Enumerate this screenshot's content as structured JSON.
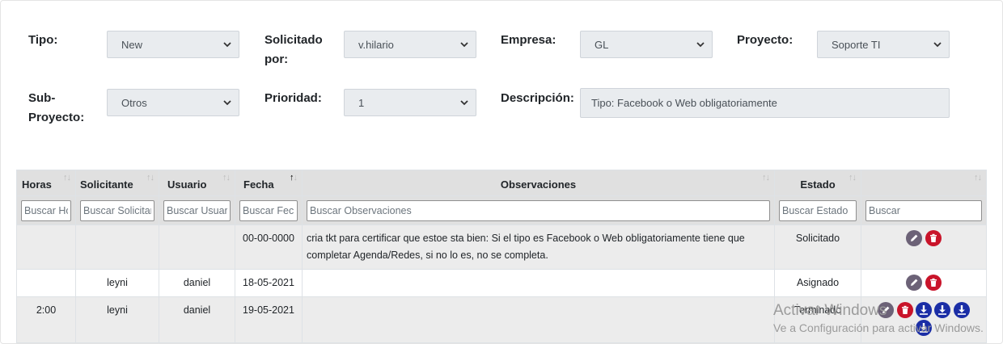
{
  "form": {
    "tipo": {
      "label": "Tipo:",
      "value": "New"
    },
    "solicitado": {
      "label_line1": "Solicitado",
      "label_line2": "por:",
      "value": "v.hilario"
    },
    "empresa": {
      "label": "Empresa:",
      "value": "GL"
    },
    "proyecto": {
      "label": "Proyecto:",
      "value": "Soporte TI"
    },
    "subproyecto": {
      "label_line1": "Sub-",
      "label_line2": "Proyecto:",
      "value": "Otros"
    },
    "prioridad": {
      "label": "Prioridad:",
      "value": "1"
    },
    "descripcion": {
      "label": "Descripción:",
      "value": "Tipo: Facebook o Web obligatoriamente"
    }
  },
  "table": {
    "columns": [
      "Horas",
      "Solicitante",
      "Usuario",
      "Fecha",
      "Observaciones",
      "Estado",
      ""
    ],
    "filters": [
      "Buscar Horas",
      "Buscar Solicitante",
      "Buscar Usuario",
      "Buscar Fecha",
      "Buscar Observaciones",
      "Buscar Estado",
      "Buscar"
    ],
    "rows": [
      {
        "horas": "",
        "solicitante": "",
        "usuario": "",
        "fecha": "00-00-0000",
        "observaciones": "cria tkt para certificar que estoe sta bien: Si el tipo es Facebook o Web obligatoriamente tiene que completar Agenda/Redes, si no lo es, no se completa.",
        "estado": "Solicitado",
        "actions": [
          "edit-icon",
          "delete-icon"
        ]
      },
      {
        "horas": "",
        "solicitante": "leyni",
        "usuario": "daniel",
        "fecha": "18-05-2021",
        "observaciones": "",
        "estado": "Asignado",
        "actions": [
          "edit-icon",
          "delete-icon"
        ]
      },
      {
        "horas": "2:00",
        "solicitante": "leyni",
        "usuario": "daniel",
        "fecha": "19-05-2021",
        "observaciones": "",
        "estado": "Terminado",
        "actions": [
          "edit-icon",
          "delete-icon",
          "download-icon",
          "download-icon",
          "download-icon",
          "download-icon"
        ]
      }
    ]
  },
  "watermark": {
    "line1": "Activar Windows",
    "line2": "Ve a Configuración para activar Windows."
  },
  "colors": {
    "edit": "#6c6277",
    "delete": "#c9142a",
    "download": "#1b2ea6",
    "header_bg": "#e0e0e0",
    "input_bg": "#e9ecef"
  }
}
